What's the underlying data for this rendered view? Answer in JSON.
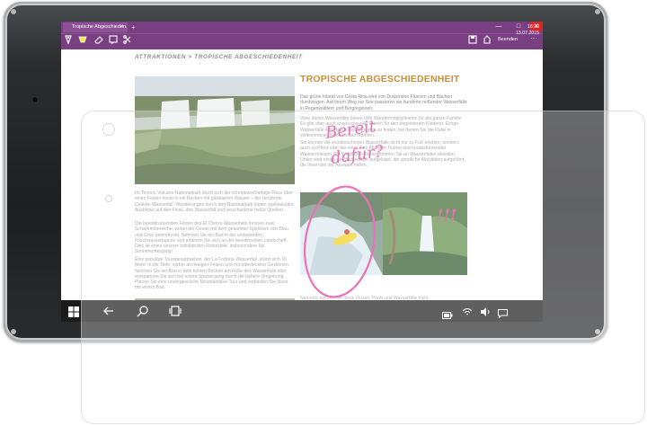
{
  "browser": {
    "tab_title": "Tropische Abgeschieden...",
    "done_label": "Beenden",
    "colors": {
      "accent": "#7a3f82",
      "heading": "#c8903a",
      "ink": "#e0359a"
    }
  },
  "icons": {
    "new_tab": "+",
    "close_tab": "×",
    "minimize": "—",
    "maximize": "□",
    "close": "✕",
    "more": "···"
  },
  "page": {
    "breadcrumb": "ATTRAKTIONEN > TROPISCHE ABGESCHIEDENHEIT",
    "heading": "TROPISCHE ABGESCHIEDENHEIT",
    "p1": "Das grüne Inland von Costa Rica wird von Dutzenden Flüssen und Bächen durchzogen. Auf ihrem Weg zur See passieren sie hunderte reißender Wasserfälle in Regenwäldern und Bergregionen.",
    "p2": "Viele dieser Wasserfälle bieten tolle Wandermöglichkeiten für die ganze Familie. Es gibt aber auch anspruchsvolle Touren für den begeisterten Kletterer. Einige Wasserfälle erfordern einen Tagestrip zu finden, bei denen Sie die Ruhe in vollkommener Ruhe erleben können.",
    "p3": "Sie können die wunderschönen Wasserfälle nicht nur zu Fuß erleben, sondern auch zu Pferd oder bei einer Tour Abseilen Touren und herabstürzenden Wassermassen. Mit Wasserfall-Touren können Sie an Wasserfällen abseilen. Unten sind einige der Wasserfälle aufgelistet, die sportliche Aktivitäten aufgeführt, die Ihnen bei der Auswahl helfen.",
    "left1": "Im Tenorio Volcano-Nationalpark stürzt sich der schneeweißfarbige Fluss über einen Felsen hinab in ein Becken mit glasklarem Wasser – der berühmte Celeste-Wasserfall. Wanderungen durch den Nationalpark bieten spektakuläre Ausblicke auf den Fluss, den Wasserfall und verschiedene heiße Quellen.",
    "left2": "Die beeindruckenden Felsen des El Chorro-Wasserfalls trennen zwei Schwimmbereiche, wobei der Ozean mit dem gesamten Spektrum von Blau und Grün beeindruckt. Nehmen Sie ein Bad in der einladenden Frischwasserlagune und erfahren Sie sich an der wundervollen Landschaft. Dies ist eines unserer beliebtesten Reiseziele, insbesondere bei Sonnenuntergang!",
    "left3": "Eine populäre Touristenattraktion, der La Fortuna-Wasserfall, stürzt sich 70 Meter in die Tiefe, vorbei an riesigen Felsen und moosbedeckten Gesteinen. Nehmen Sie ein Bad in dem kühlen Becken am Fuße des Wasserfalls oder entspannen Sie sich bei einem Spaziergang durch die nähere Umgebung. Planen Sie eine unvergessliche Mountainbike-Tour und verbinden Sie diese mit einem Bad.",
    "bottom": "Natürlich können Sie diese Flüsse, Pools und Wasserfälle nicht",
    "ink1": "Bereit",
    "ink2": "dafür?",
    "ink3": "!!!"
  },
  "taskbar": {
    "time": "16:30",
    "date": "13.07.2015"
  }
}
